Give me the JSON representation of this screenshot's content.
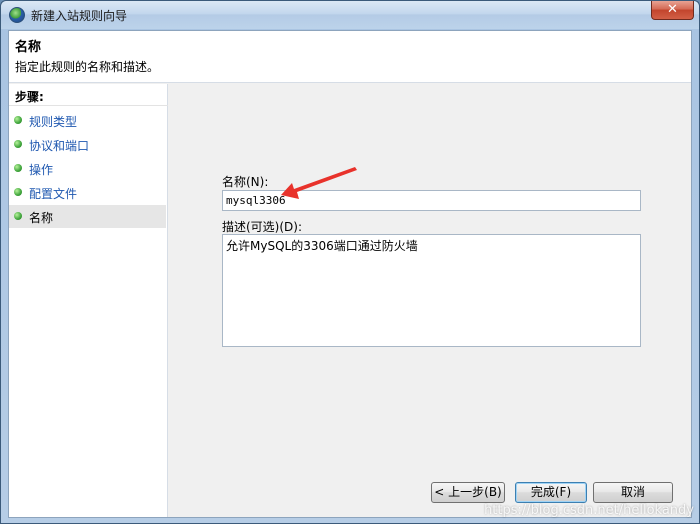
{
  "window": {
    "title": "新建入站规则向导",
    "close_glyph": "✕"
  },
  "header": {
    "title": "名称",
    "description": "指定此规则的名称和描述。"
  },
  "steps": {
    "heading": "步骤:",
    "items": [
      {
        "label": "规则类型"
      },
      {
        "label": "协议和端口"
      },
      {
        "label": "操作"
      },
      {
        "label": "配置文件"
      },
      {
        "label": "名称"
      }
    ]
  },
  "form": {
    "name_label": "名称(N):",
    "name_value": "mysql3306",
    "desc_label": "描述(可选)(D):",
    "desc_value": "允许MySQL的3306端口通过防火墙"
  },
  "buttons": {
    "back": "< 上一步(B)",
    "finish": "完成(F)",
    "cancel": "取消"
  },
  "watermark": "https://blog.csdn.net/hellokandy",
  "colors": {
    "step_link": "#1f58b0",
    "arrow": "#e8322b"
  }
}
